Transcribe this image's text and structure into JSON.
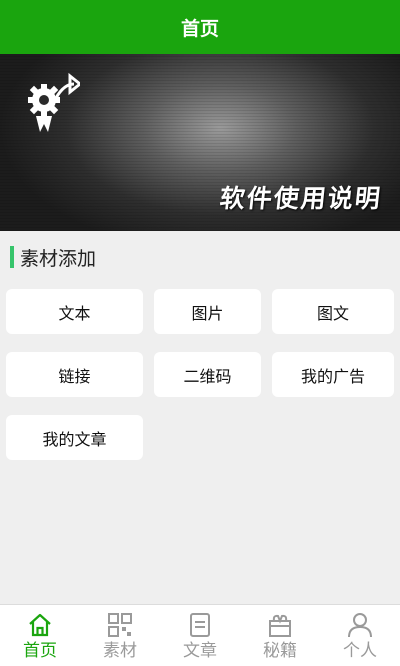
{
  "header": {
    "title": "首页"
  },
  "banner": {
    "text": "软件使用说明"
  },
  "section": {
    "title": "素材添加"
  },
  "tiles": [
    {
      "label": "文本"
    },
    {
      "label": "图片"
    },
    {
      "label": "图文"
    },
    {
      "label": "链接"
    },
    {
      "label": "二维码"
    },
    {
      "label": "我的广告"
    },
    {
      "label": "我的文章"
    }
  ],
  "tabs": [
    {
      "label": "首页",
      "icon": "home-icon",
      "active": true
    },
    {
      "label": "素材",
      "icon": "grid-icon",
      "active": false
    },
    {
      "label": "文章",
      "icon": "document-icon",
      "active": false
    },
    {
      "label": "秘籍",
      "icon": "gift-icon",
      "active": false
    },
    {
      "label": "个人",
      "icon": "person-icon",
      "active": false
    }
  ],
  "colors": {
    "brand_green": "#1aa50e",
    "section_accent": "#36c46b",
    "tab_active": "#1aa50e",
    "tab_inactive": "#9a9a9a"
  }
}
